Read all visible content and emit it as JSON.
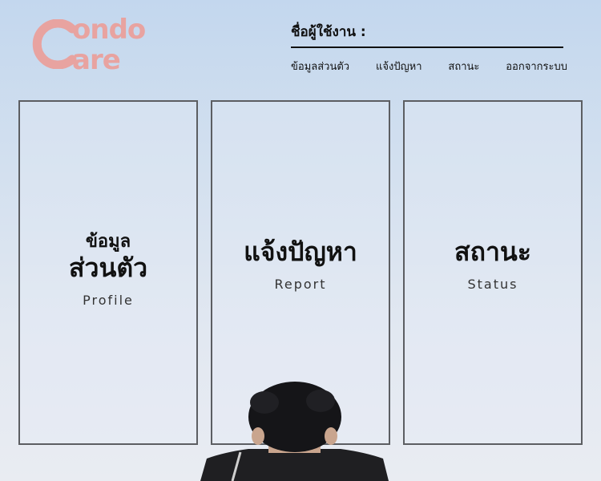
{
  "logo": {
    "line1": "ondo",
    "line2": "are"
  },
  "header": {
    "user_label": "ชื่อผู้ใช้งาน :"
  },
  "nav": [
    "ข้อมูลส่วนตัว",
    "แจ้งปัญหา",
    "สถานะ",
    "ออกจากระบบ"
  ],
  "cards": [
    {
      "line1": "ข้อมูล",
      "line2": "ส่วนตัว",
      "subtitle": "Profile"
    },
    {
      "title": "แจ้งปัญหา",
      "subtitle": "Report"
    },
    {
      "title": "สถานะ",
      "subtitle": "Status"
    }
  ],
  "colors": {
    "brand": "#e8a3a0",
    "card_border": "#5c5e62",
    "sky_top": "#c3d7ee"
  },
  "icons": {
    "logo": "condo-care-logo"
  }
}
